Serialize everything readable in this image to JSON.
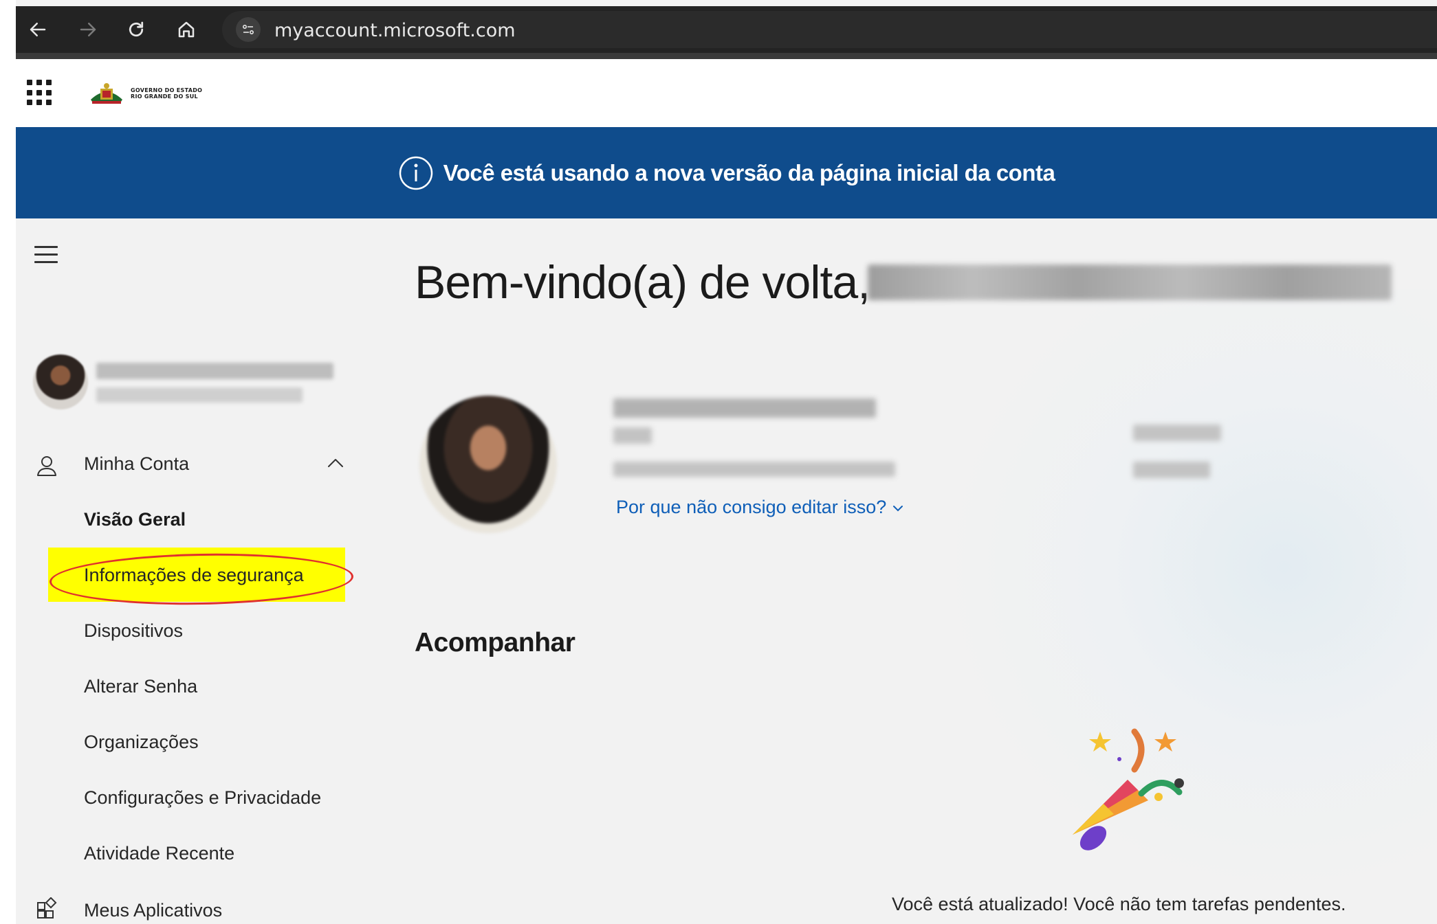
{
  "browser": {
    "url": "myaccount.microsoft.com"
  },
  "header": {
    "org_name_line1": "GOVERNO DO ESTADO",
    "org_name_line2": "RIO GRANDE DO SUL"
  },
  "banner": {
    "text": "Você está usando a nova versão da página inicial da conta",
    "color": "#0f4c8c"
  },
  "sidebar": {
    "section_label": "Minha Conta",
    "items": [
      {
        "label": "Visão Geral",
        "selected": true
      },
      {
        "label": "Informações de segurança",
        "highlighted": true
      },
      {
        "label": "Dispositivos"
      },
      {
        "label": "Alterar Senha"
      },
      {
        "label": "Organizações"
      },
      {
        "label": "Configurações e Privacidade"
      },
      {
        "label": "Atividade Recente"
      }
    ],
    "apps_label": "Meus Aplicativos"
  },
  "main": {
    "welcome": "Bem-vindo(a) de volta,",
    "edit_link": "Por que não consigo editar isso?",
    "section_title": "Acompanhar",
    "empty_message": "Você está atualizado! Você não tem tarefas pendentes."
  },
  "colors": {
    "accent_link": "#0f5fb8",
    "highlight": "#ffff00",
    "annotation": "#e0302e"
  }
}
